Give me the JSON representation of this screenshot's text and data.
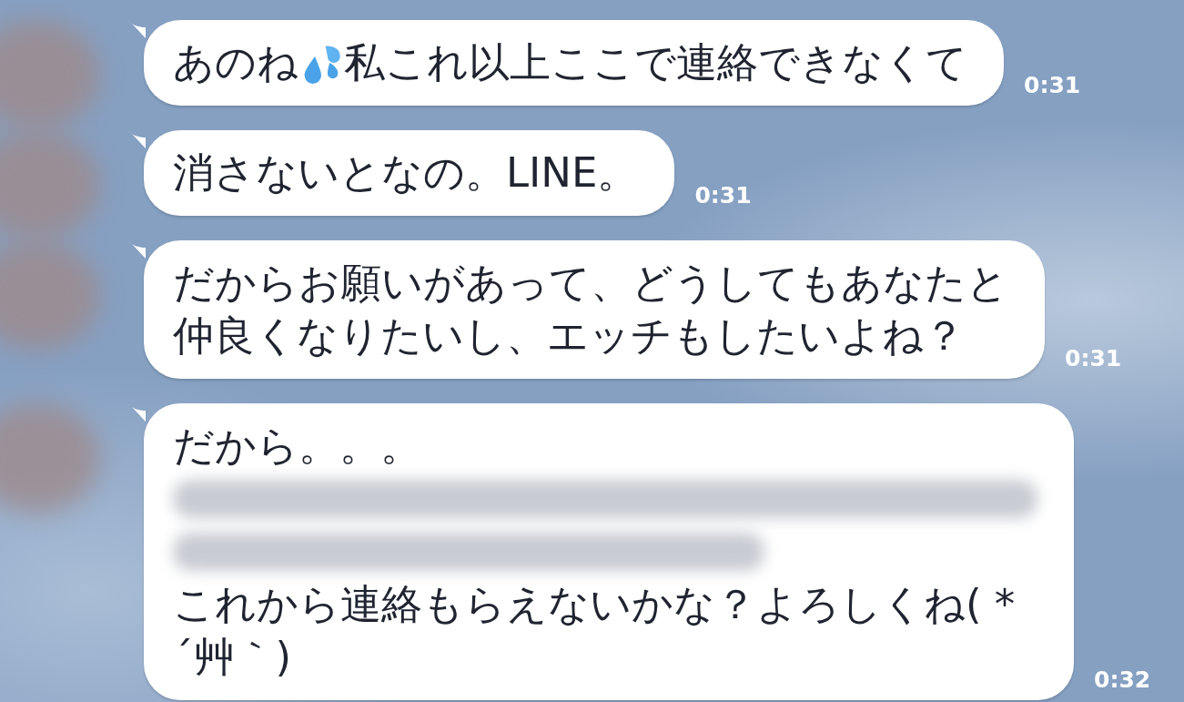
{
  "messages": [
    {
      "lines": [
        [
          {
            "kind": "text",
            "text": "あのね"
          },
          {
            "kind": "sweat"
          },
          {
            "kind": "text",
            "text": "私これ以上ここで連絡できなくて"
          }
        ]
      ],
      "time": "0:31"
    },
    {
      "lines": [
        [
          {
            "kind": "text",
            "text": "消さないとなの。LINE。"
          }
        ]
      ],
      "time": "0:31"
    },
    {
      "lines": [
        [
          {
            "kind": "text",
            "text": "だからお願いがあって、どうしてもあなたと"
          }
        ],
        [
          {
            "kind": "text",
            "text": "仲良くなりたいし、エッチもしたいよね？"
          }
        ]
      ],
      "time": "0:31"
    },
    {
      "lines": [
        [
          {
            "kind": "text",
            "text": "だから。。。"
          }
        ],
        [
          {
            "kind": "redacted"
          }
        ],
        [
          {
            "kind": "redacted"
          }
        ],
        [
          {
            "kind": "text",
            "text": "これから連絡もらえないかな？よろしくね( *"
          }
        ],
        [
          {
            "kind": "text",
            "text": "´艸｀)"
          }
        ]
      ],
      "time": "0:32"
    }
  ]
}
